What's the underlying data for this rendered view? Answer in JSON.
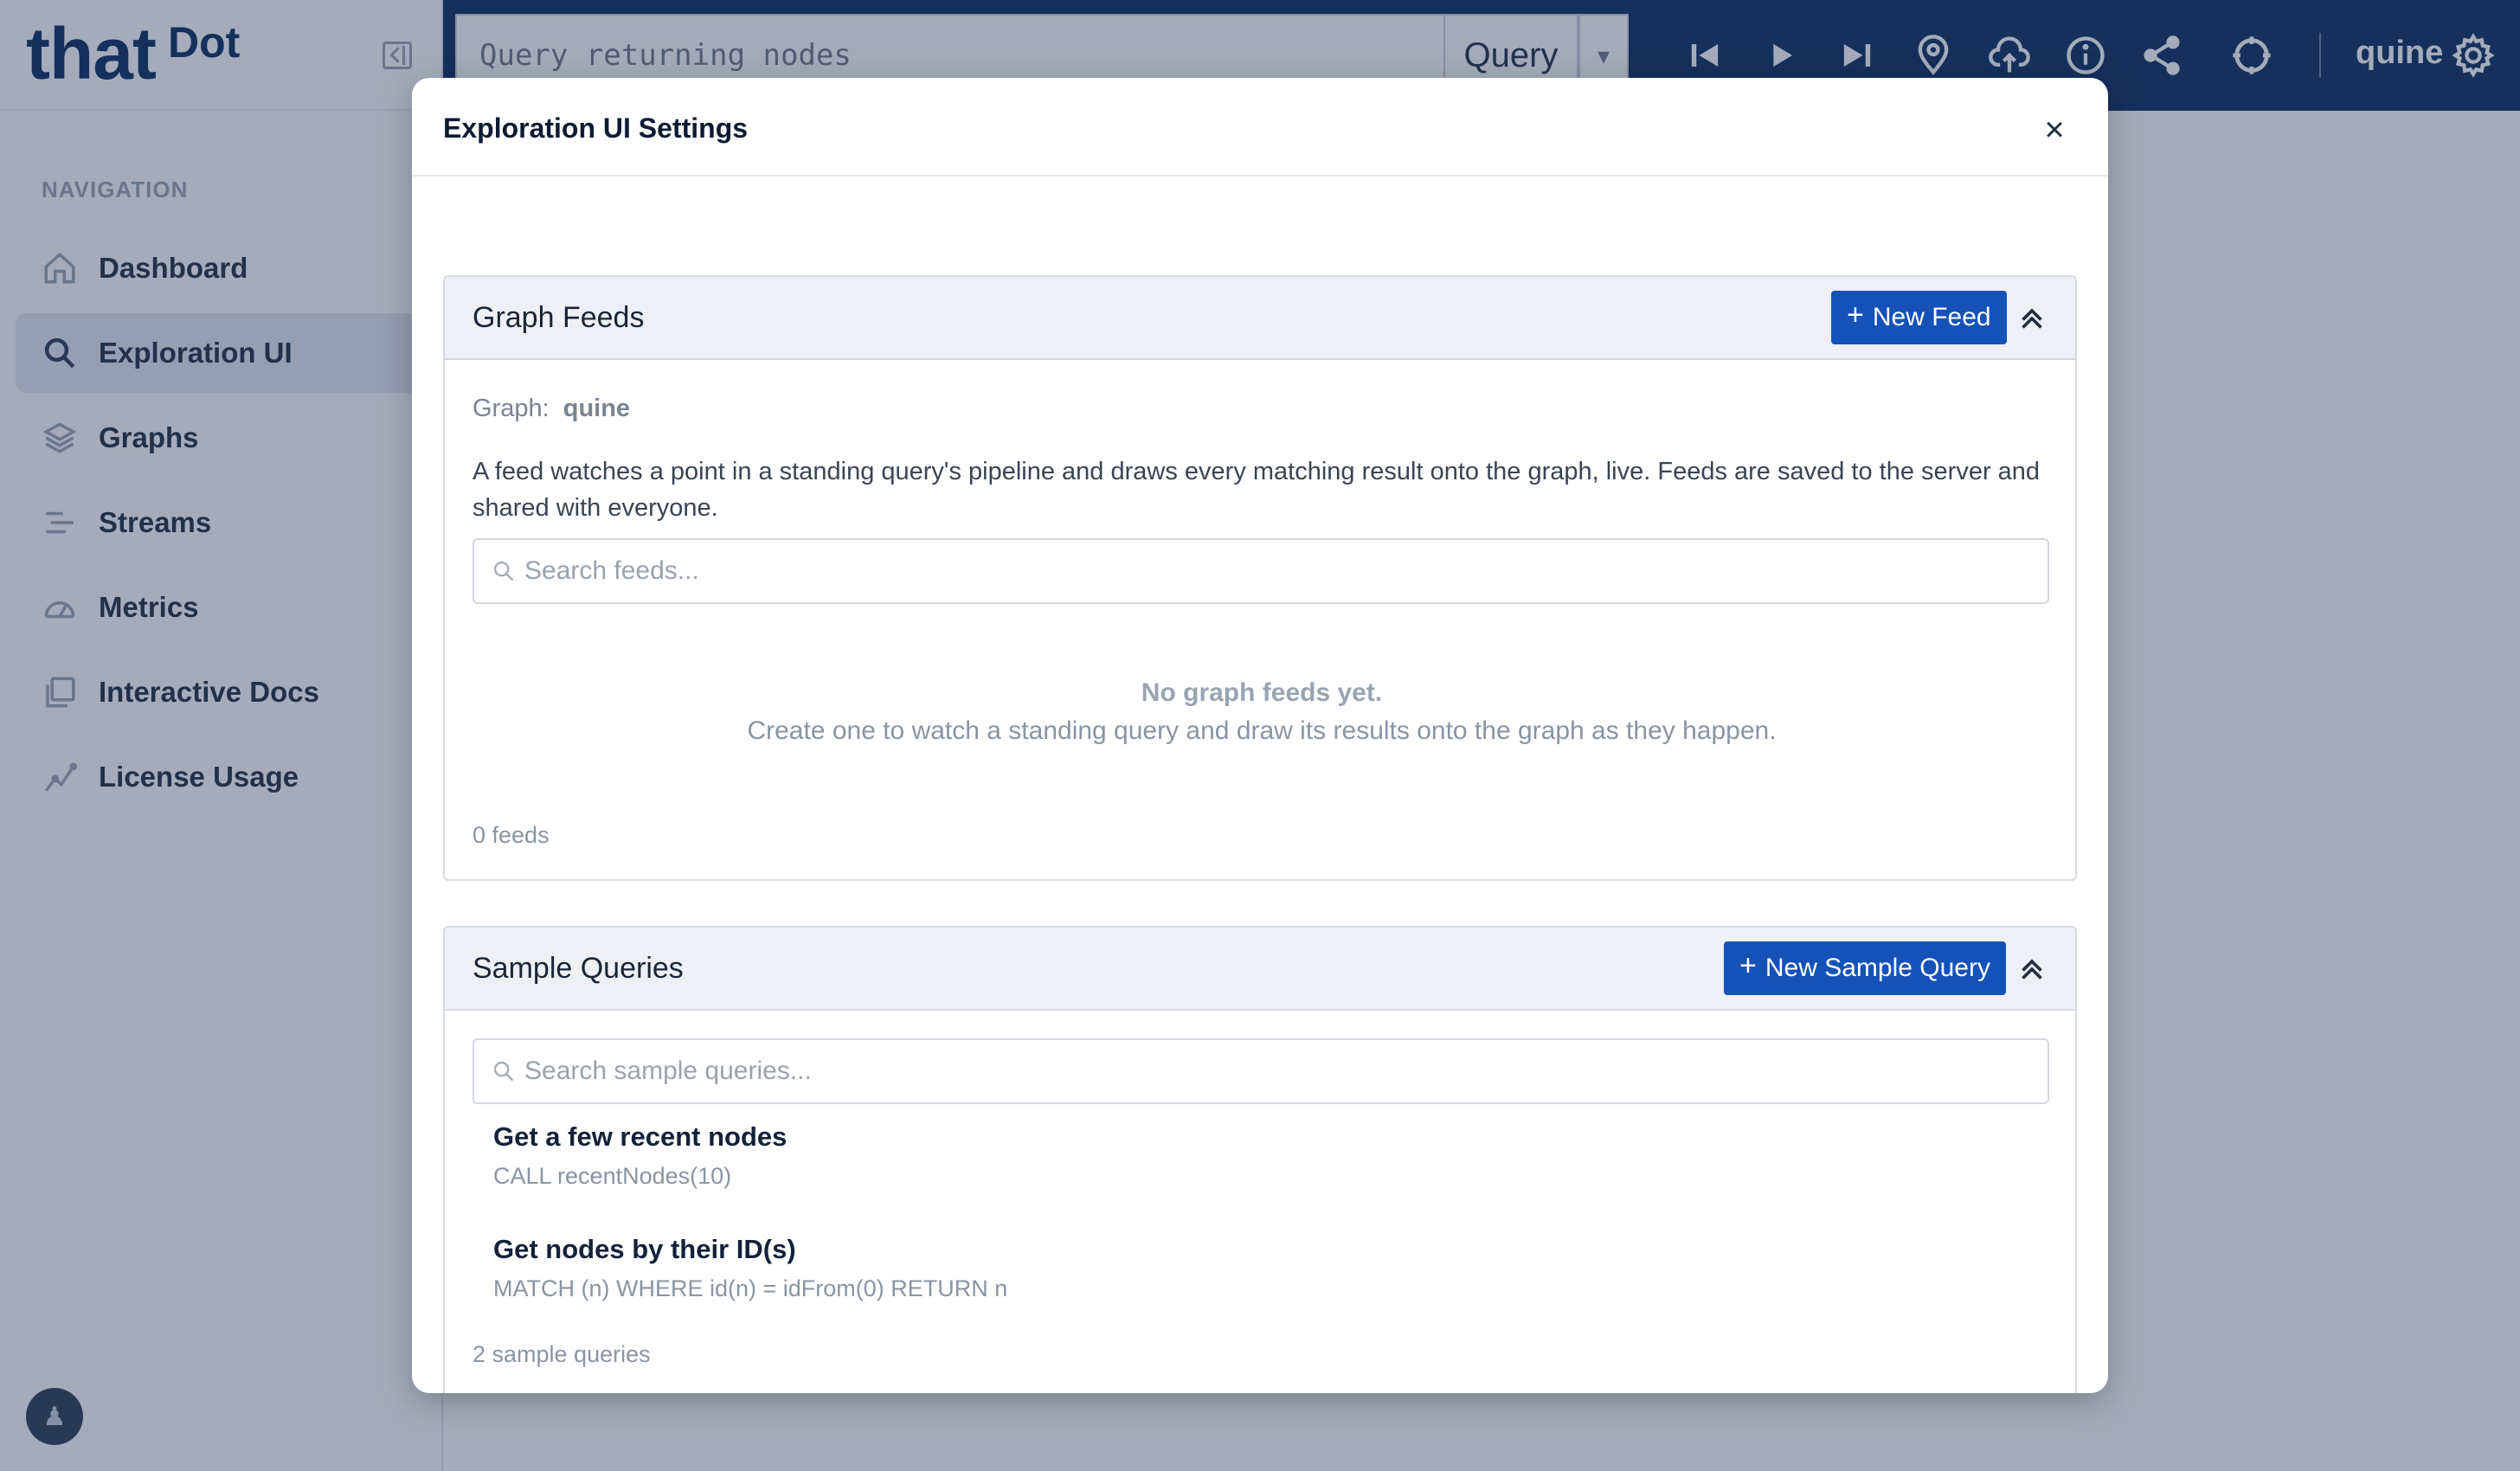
{
  "brand": {
    "logo_main": "that",
    "logo_sup": "Dot"
  },
  "sidebar": {
    "heading": "NAVIGATION",
    "items": [
      {
        "label": "Dashboard",
        "icon": "home-icon",
        "active": false
      },
      {
        "label": "Exploration UI",
        "icon": "search-icon",
        "active": true
      },
      {
        "label": "Graphs",
        "icon": "layers-icon",
        "active": false
      },
      {
        "label": "Streams",
        "icon": "streams-icon",
        "active": false
      },
      {
        "label": "Metrics",
        "icon": "gauge-icon",
        "active": false
      },
      {
        "label": "Interactive Docs",
        "icon": "docs-icon",
        "active": false
      },
      {
        "label": "License Usage",
        "icon": "usage-chart-icon",
        "active": false
      }
    ]
  },
  "topbar": {
    "query_placeholder": "Query returning nodes",
    "query_button": "Query",
    "graph_name": "quine",
    "icons": [
      "skip-back-icon",
      "play-icon",
      "skip-forward-icon",
      "pin-icon",
      "cloud-upload-icon",
      "info-icon",
      "share-icon",
      "target-icon",
      "gear-icon"
    ]
  },
  "modal": {
    "title": "Exploration UI Settings",
    "close": "×",
    "feeds": {
      "title": "Graph Feeds",
      "new_button": "New Feed",
      "graph_label": "Graph:",
      "graph_value": "quine",
      "description": "A feed watches a point in a standing query's pipeline and draws every matching result onto the graph, live. Feeds are saved to the server and shared with everyone.",
      "search_placeholder": "Search feeds...",
      "empty_title": "No graph feeds yet.",
      "empty_sub": "Create one to watch a standing query and draw its results onto the graph as they happen.",
      "count": "0 feeds"
    },
    "samples": {
      "title": "Sample Queries",
      "new_button": "New Sample Query",
      "search_placeholder": "Search sample queries...",
      "items": [
        {
          "title": "Get a few recent nodes",
          "query": "CALL recentNodes(10)"
        },
        {
          "title": "Get nodes by their ID(s)",
          "query": "MATCH (n) WHERE id(n) = idFrom(0) RETURN n"
        }
      ],
      "count": "2 sample queries"
    }
  },
  "colors": {
    "navy": "#0b2a5e",
    "primary": "#1452b8",
    "overlay": "rgba(38,58,92,0.42)"
  }
}
